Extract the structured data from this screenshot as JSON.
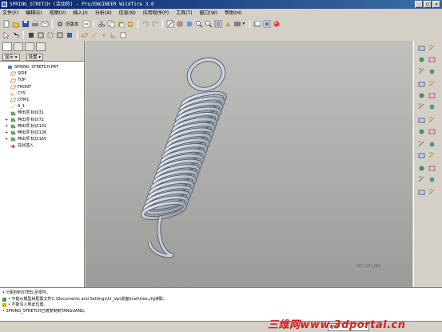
{
  "window": {
    "title": "SPRING_STRETCH (活动的) - Pro/ENGINEER Wildfire 3.0",
    "minimize": "_",
    "maximize": "□",
    "close": "×"
  },
  "menu": [
    "文件(F)",
    "编辑(E)",
    "视图(V)",
    "插入(I)",
    "分析(A)",
    "信息(N)",
    "应用程序(P)",
    "工具(T)",
    "窗口(W)",
    "帮助(H)"
  ],
  "toolbar": {
    "combo_label": "旧版本"
  },
  "panel": {
    "display_btn": "显示 ▾",
    "settings_btn": "设置 ▾"
  },
  "tree": [
    {
      "label": "SPRING_STRETCH.PRT",
      "expand": "",
      "icon": "part-icon"
    },
    {
      "label": "SIDE",
      "expand": "",
      "icon": "datum-plane-icon"
    },
    {
      "label": "TOP",
      "expand": "",
      "icon": "datum-plane-icon"
    },
    {
      "label": "FRONT",
      "expand": "",
      "icon": "datum-plane-icon"
    },
    {
      "label": "CYS",
      "expand": "",
      "icon": "coord-sys-icon"
    },
    {
      "label": "DTM1",
      "expand": "",
      "icon": "datum-plane-icon"
    },
    {
      "label": "A_1",
      "expand": "",
      "icon": "datum-axis-icon"
    },
    {
      "label": "伸出项 标识31",
      "expand": "",
      "icon": "protrusion-icon"
    },
    {
      "label": "伸出项 标识72",
      "expand": "+",
      "icon": "protrusion-icon"
    },
    {
      "label": "伸出项 标识101",
      "expand": "+",
      "icon": "protrusion-icon"
    },
    {
      "label": "伸出项 标识136",
      "expand": "+",
      "icon": "protrusion-icon"
    },
    {
      "label": "伸出项 标识165",
      "expand": "+",
      "icon": "protrusion-icon"
    },
    {
      "label": "在此插入",
      "expand": "",
      "icon": "insert-here-icon"
    }
  ],
  "viewport": {
    "label": "PRT_CSYS_DEF"
  },
  "status": [
    "• 分配材料STEEL至零件。",
    "• 不能从模型树配置文件C:\\Documents and Settings\\hr_lzp\\桌面\\trail\\tree.cfg读取。",
    "• 不能写入到此位置。",
    "• SPRING_STRETCH已被复制到TANGUANG。"
  ],
  "bottom": {
    "filter": "智能"
  },
  "watermark": "三维网www.3dportal.cn"
}
